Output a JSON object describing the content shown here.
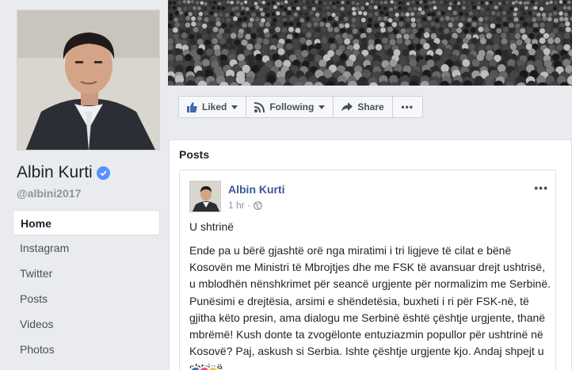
{
  "profile": {
    "name": "Albin Kurti",
    "handle": "@albini2017",
    "verified_color": "#5890ff"
  },
  "nav": {
    "items": [
      {
        "label": "Home",
        "active": true
      },
      {
        "label": "Instagram"
      },
      {
        "label": "Twitter"
      },
      {
        "label": "Posts"
      },
      {
        "label": "Videos"
      },
      {
        "label": "Photos"
      }
    ]
  },
  "actions": {
    "liked_label": "Liked",
    "following_label": "Following",
    "share_label": "Share",
    "more_label": "•••"
  },
  "posts": {
    "section_title": "Posts",
    "post": {
      "author": "Albin Kurti",
      "time": "1 hr ·",
      "more_label": "•••",
      "lead": "U shtrinë",
      "body": "Ende pa u bërë gjashtë orë nga miratimi i tri ligjeve të cilat e bënë Kosovën me Ministri të Mbrojtjes dhe me FSK të avansuar drejt ushtrisë, u mblodhën nënshkrimet për seancë urgjente për normalizim me Serbinë. Punësimi e drejtësia, arsimi e shëndetësia, buxheti i ri për FSK-në, të gjitha këto presin, ama dialogu me Serbinë është çështje urgjente, thanë mbrëmë! Kush donte ta zvogëlonte entuziazmin popullor për ushtrinë në Kosovë? Paj, askush si Serbia. Ishte çështje urgjente kjo. Andaj shpejt u shtrinë."
    }
  },
  "colors": {
    "link": "#365899",
    "page_bg": "#e9ebee",
    "like_blue": "#4267b2"
  },
  "icons": [
    "thumbs-up-icon",
    "rss-icon",
    "share-arrow-icon",
    "globe-icon",
    "verified-check-icon",
    "caret-down-icon"
  ]
}
